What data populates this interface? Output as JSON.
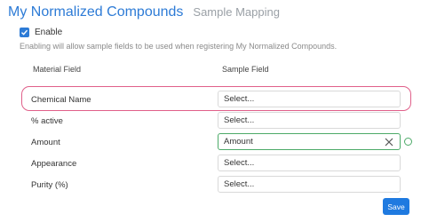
{
  "tabs": {
    "active": "My Normalized Compounds",
    "inactive": "Sample Mapping"
  },
  "enable": {
    "label": "Enable",
    "checked": true,
    "help": "Enabling will allow sample fields to be used when registering My Normalized Compounds."
  },
  "columns": {
    "material": "Material Field",
    "sample": "Sample Field"
  },
  "rows": [
    {
      "label": "Chemical Name",
      "value": "Select..."
    },
    {
      "label": "% active",
      "value": "Select..."
    },
    {
      "label": "Amount",
      "value": "Amount"
    },
    {
      "label": "Appearance",
      "value": "Select..."
    },
    {
      "label": "Purity (%)",
      "value": "Select..."
    }
  ],
  "save_label": "Save",
  "colors": {
    "accent": "#2d7bd6",
    "highlight": "#e0608a",
    "valid": "#4caa68",
    "button": "#1f7ae0"
  }
}
